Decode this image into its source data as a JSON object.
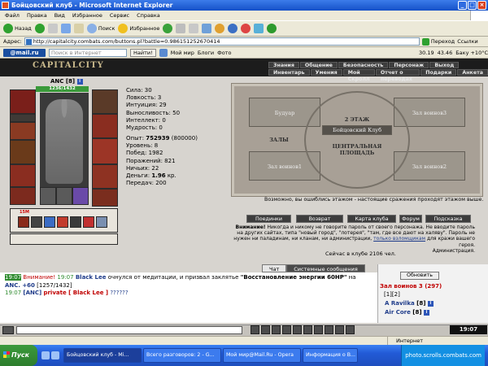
{
  "window": {
    "title": "Бойцовский клуб - Microsoft Internet Explorer"
  },
  "menu": [
    "Файл",
    "Правка",
    "Вид",
    "Избранное",
    "Сервис",
    "Справка"
  ],
  "toolbar": {
    "back": "Назад",
    "search": "Поиск",
    "favorites": "Избранное"
  },
  "address": {
    "label": "Адрес:",
    "url": "http://capitalcity.combats.com/buttons.pl?battle=0.986151252670414",
    "go": "Переход",
    "links": "Ссылки"
  },
  "mailbar": {
    "logo": "@mail.ru",
    "search_placeholder": "Поиск в Интернет",
    "find": "Найти!",
    "mymir": "Мой мир",
    "blogs": "Блоги",
    "photo": "Фото",
    "rate1": "30.19",
    "rate2": "43.46",
    "weather": "Баку +10°C"
  },
  "game": {
    "logo": "CAPITALCITY",
    "nav_top": [
      "Знания",
      "Общение",
      "Безопасность",
      "Персонаж",
      "Выход"
    ],
    "nav_sub": [
      "Инвентарь",
      "Умения",
      "Мой Скролл",
      "Отчет о переводах",
      "Подарки",
      "Анкета"
    ],
    "char_name": "ANC",
    "char_level": "[8]",
    "hp": "1236/1432",
    "slot_badge": "15M",
    "stats": [
      {
        "label": "Сила:",
        "value": "30"
      },
      {
        "label": "Ловкость:",
        "value": "3"
      },
      {
        "label": "Интуиция:",
        "value": "29"
      },
      {
        "label": "Выносливость:",
        "value": "50"
      },
      {
        "label": "Интеллект:",
        "value": "0"
      },
      {
        "label": "Мудрость:",
        "value": "0"
      }
    ],
    "exp_label": "Опыт:",
    "exp_value": "752939",
    "exp_next": "(800000)",
    "level_label": "Уровень:",
    "level_value": "8",
    "wins_label": "Побед:",
    "wins_value": "1982",
    "losses_label": "Поражений:",
    "losses_value": "821",
    "draws_label": "Ничьих:",
    "draws_value": "22",
    "money_label": "Деньги:",
    "money_value": "1.96",
    "money_unit": "кр.",
    "transfers_label": "Передач:",
    "transfers_value": "200",
    "map": {
      "floor": "2 ЭТАЖ",
      "club": "Бойцовский Клуб",
      "square": "ЦЕНТРАЛЬНАЯ\nПЛОЩАДЬ",
      "halls": "ЗАЛЫ",
      "buduar": "Будуар",
      "room1": "Зал воинов1",
      "room2": "Зал воинов2",
      "room3": "Зал воинов3"
    },
    "map_hint": "Возможно, вы ошиблись этажом - настоящие сражения проходят этажом выше.",
    "buttons": [
      "Поединки",
      "Возврат",
      "Карта клуба",
      "Форум",
      "Подсказка"
    ],
    "warning_title": "Внимание!",
    "warning_text": "Никогда и никому не говорите пароль от своего персонажа. Не вводите пароль на других сайтах, типа \"новый город\", \"лотерея\", \"там, где все дают на халяву\". Пароль не нужен ни паладинам, ни кланам, ни администрации,",
    "warning_link": "только взломщикам",
    "warning_tail": "для кражи вашего героя.",
    "warning_sign": "Администрация.",
    "online": "Сейчас в клубе 2106 чел."
  },
  "chat": {
    "tabs": [
      "Чат",
      "Системные сообщения"
    ],
    "line1": {
      "time": "19:07",
      "warn": "Внимание!",
      "time2": "19:07",
      "who": "Black Lee",
      "text": "очнулся от медитации, и призвал заклятье",
      "spell": "\"Восстановление энергии 60HP\"",
      "on": "на",
      "target": "ANC.",
      "amount": "+60",
      "hp": "[1257/1432]"
    },
    "line2": {
      "time": "19:07",
      "from": "[ANC]",
      "private": "private [ Black Lee ]",
      "msg": "??????"
    }
  },
  "room_panel": {
    "refresh": "Обновить",
    "room": "Зал воинов 3 (297)",
    "pages": "[1][2]",
    "players": [
      {
        "name": "A Ravilka",
        "level": "[8]"
      },
      {
        "name": "Air Core",
        "level": "[8]"
      }
    ]
  },
  "clock": "19:07",
  "status": {
    "zone": "Интернет"
  },
  "taskbar": {
    "start": "Пуск",
    "tasks": [
      "Бойцовский клуб - Mi...",
      "Всего разговоров: 2 - G...",
      "Мой мир@Mail.Ru - Opera",
      "Информация о В..."
    ],
    "tray": "photo.scrolls.combats.com"
  },
  "colors": {
    "accent_red": "#c00000",
    "link_blue": "#1f3c8a",
    "game_dark": "#1c1c1c"
  }
}
